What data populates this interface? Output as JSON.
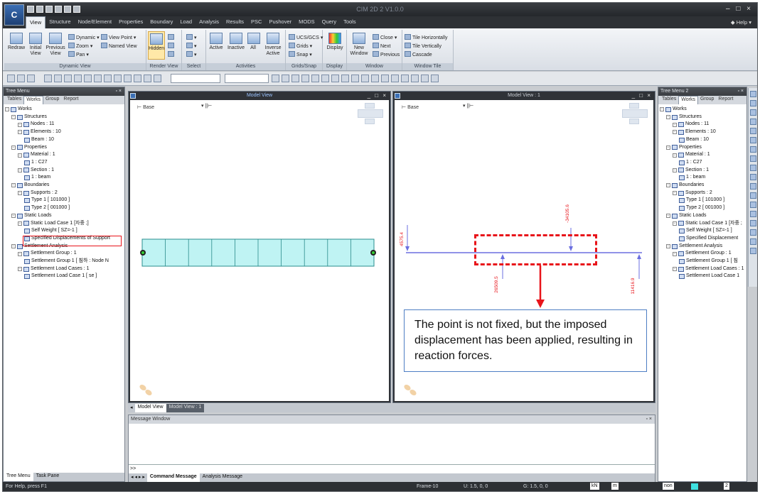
{
  "app": {
    "title": "CIM 2D 2 V1.0.0",
    "help": "Help",
    "logo": "C",
    "window_controls": "– □ ×"
  },
  "menu_tabs": [
    "View",
    "Structure",
    "Node/Element",
    "Properties",
    "Boundary",
    "Load",
    "Analysis",
    "Results",
    "PSC",
    "Pushover",
    "MODS",
    "Query",
    "Tools"
  ],
  "active_tab": "View",
  "ribbon": {
    "dynamic_view": {
      "title": "Dynamic View",
      "redraw": "Redraw",
      "initial_view": "Initial\nView",
      "previous_view": "Previous\nView",
      "dynamic": "Dynamic",
      "zoom": "Zoom",
      "pan": "Pan",
      "view_point": "View Point",
      "named_view": "Named View"
    },
    "render_view": {
      "title": "Render View",
      "hidden": "Hidden"
    },
    "select": {
      "title": "Select"
    },
    "activities": {
      "title": "Activities",
      "active": "Active",
      "inactive": "Inactive",
      "all": "All",
      "inverse_active": "Inverse\nActive"
    },
    "grids_snap": {
      "title": "Grids/Snap",
      "ucs": "UCS/GCS",
      "grids": "Grids",
      "snap": "Snap"
    },
    "display": {
      "title": "Display",
      "display": "Display"
    },
    "window": {
      "title": "Window",
      "new_window": "New\nWindow",
      "close": "Close",
      "next": "Next",
      "previous": "Previous"
    },
    "window_tile": {
      "title": "Window Tile",
      "horizontally": "Tile Horizontally",
      "vertically": "Tile Vertically",
      "cascade": "Cascade"
    }
  },
  "left_panel": {
    "header": "Tree Menu",
    "tabs": [
      "Tables",
      "Works",
      "Group",
      "Report"
    ],
    "active_tab": "Works",
    "tree": [
      {
        "label": "Works",
        "level": 0
      },
      {
        "label": "Structures",
        "level": 1
      },
      {
        "label": "Nodes : 11",
        "level": 2
      },
      {
        "label": "Elements : 10",
        "level": 2
      },
      {
        "label": "Beam : 10",
        "level": 3
      },
      {
        "label": "Properties",
        "level": 1
      },
      {
        "label": "Material : 1",
        "level": 2
      },
      {
        "label": "1 : C27",
        "level": 3
      },
      {
        "label": "Section : 1",
        "level": 2
      },
      {
        "label": "1 : beam",
        "level": 3
      },
      {
        "label": "Boundaries",
        "level": 1
      },
      {
        "label": "Supports : 2",
        "level": 2
      },
      {
        "label": "Type 1 [ 101000 ]",
        "level": 3
      },
      {
        "label": "Type 2 [ 001000 ]",
        "level": 3
      },
      {
        "label": "Static Loads",
        "level": 1
      },
      {
        "label": "Static Load Case 1 [자중 ;]",
        "level": 2
      },
      {
        "label": "Self Weight [ SZ=-1 ]",
        "level": 3
      },
      {
        "label": "Specified Displacements of Support",
        "level": 3,
        "highlight": true
      },
      {
        "label": "Settlement Analysis",
        "level": 1
      },
      {
        "label": "Settlement Group : 1",
        "level": 2
      },
      {
        "label": "Settlement Group 1 [ 침하 : Node N",
        "level": 3
      },
      {
        "label": "Settlement Load Cases : 1",
        "level": 2
      },
      {
        "label": "Settlement Load Case 1 [ se ]",
        "level": 3
      }
    ],
    "bottom_tabs": [
      "Tree Menu",
      "Task Pane"
    ]
  },
  "right_panel": {
    "header": "Tree Menu 2",
    "tabs": [
      "Tables",
      "Works",
      "Group",
      "Report"
    ],
    "active_tab": "Works",
    "tree": [
      {
        "label": "Works",
        "level": 0
      },
      {
        "label": "Structures",
        "level": 1
      },
      {
        "label": "Nodes : 11",
        "level": 2
      },
      {
        "label": "Elements : 10",
        "level": 2
      },
      {
        "label": "Beam : 10",
        "level": 3
      },
      {
        "label": "Properties",
        "level": 1
      },
      {
        "label": "Material : 1",
        "level": 2
      },
      {
        "label": "1 : C27",
        "level": 3
      },
      {
        "label": "Section : 1",
        "level": 2
      },
      {
        "label": "1 : beam",
        "level": 3
      },
      {
        "label": "Boundaries",
        "level": 1
      },
      {
        "label": "Supports : 2",
        "level": 2
      },
      {
        "label": "Type 1 [ 101000 ]",
        "level": 3
      },
      {
        "label": "Type 2 [ 001000 ]",
        "level": 3
      },
      {
        "label": "Static Loads",
        "level": 1
      },
      {
        "label": "Static Load Case 1 [자중 ;",
        "level": 2
      },
      {
        "label": "Self Weight [ SZ=-1 ]",
        "level": 3
      },
      {
        "label": "Specified Displacement",
        "level": 3
      },
      {
        "label": "Settlement Analysis",
        "level": 1
      },
      {
        "label": "Settlement Group : 1",
        "level": 2
      },
      {
        "label": "Settlement Group 1 [ 침",
        "level": 3
      },
      {
        "label": "Settlement Load Cases : 1",
        "level": 2
      },
      {
        "label": "Settlement Load Case 1",
        "level": 3
      }
    ]
  },
  "model_view_left": {
    "title": "Model View",
    "base_label": "Base"
  },
  "model_view_right": {
    "title": "Model View : 1",
    "base_label": "Base",
    "reactions": {
      "r1": "4575.4",
      "r2": "-34105.6",
      "r3": "26509.5",
      "r4": "11416.9"
    }
  },
  "view_tabs": [
    "Model View",
    "Model View : 1"
  ],
  "message_window": {
    "title": "Message Window",
    "prompt": ">>",
    "tabs": [
      "Command Message",
      "Analysis Message"
    ]
  },
  "callout": {
    "text": "The point is not fixed, but the imposed displacement has been applied, resulting in reaction forces."
  },
  "status": {
    "help": "For Help, press F1",
    "frame": "Frame-10",
    "u": "U: 1.5, 0, 0",
    "g": "G: 1.5, 0, 0",
    "unit_force": "kN",
    "unit_length": "m",
    "none": "non",
    "page": "2"
  },
  "colors": {
    "beam_fill": "#bff3f3",
    "beam_stroke": "#2a8c8c",
    "reaction": "#6b6fe0",
    "callout_box": "#4e7ec4",
    "annotation_red": "#e8141a"
  }
}
